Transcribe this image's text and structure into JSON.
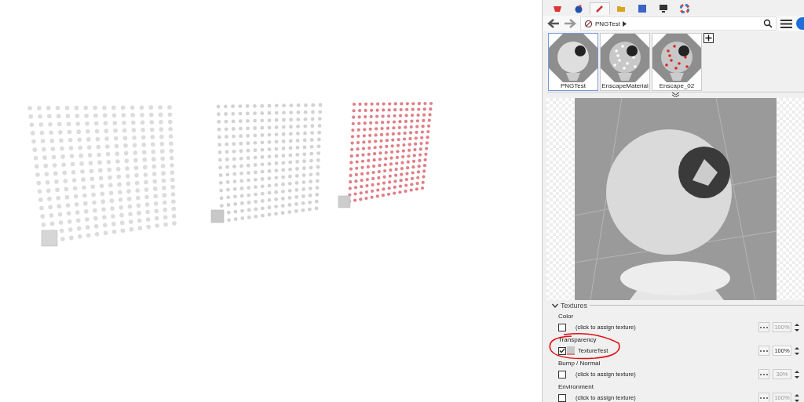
{
  "panel": {
    "tabs": [
      {
        "selected": false
      },
      {
        "selected": false
      },
      {
        "selected": true
      },
      {
        "selected": false
      },
      {
        "selected": false
      },
      {
        "selected": false
      },
      {
        "selected": false
      }
    ],
    "breadcrumb": "PNGTest",
    "materials": [
      {
        "name": "PNGTest",
        "selected": true
      },
      {
        "name": "EnscapeMaterial",
        "selected": false
      },
      {
        "name": "Enscape_02",
        "selected": false
      }
    ],
    "textures": {
      "title": "Textures",
      "expanded": true,
      "slots": [
        {
          "label": "Color",
          "checked": false,
          "texture": "(click to assign texture)",
          "assigned": false,
          "amount": "100%",
          "circled": false
        },
        {
          "label": "Transparency",
          "checked": true,
          "texture": "TextureTest",
          "assigned": true,
          "amount": "100%",
          "circled": true
        },
        {
          "label": "Bump / Normal",
          "checked": false,
          "texture": "(click to assign texture)",
          "assigned": false,
          "amount": "30%",
          "circled": false
        },
        {
          "label": "Environment",
          "checked": false,
          "texture": "(click to assign texture)",
          "assigned": false,
          "amount": "100%",
          "circled": false
        }
      ]
    }
  }
}
